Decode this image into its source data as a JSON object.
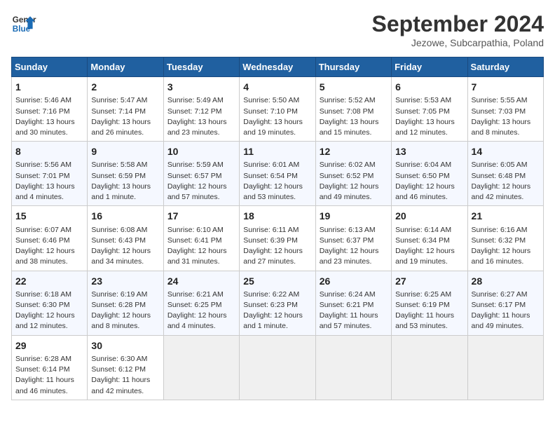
{
  "header": {
    "logo_line1": "General",
    "logo_line2": "Blue",
    "month": "September 2024",
    "location": "Jezowe, Subcarpathia, Poland"
  },
  "columns": [
    "Sunday",
    "Monday",
    "Tuesday",
    "Wednesday",
    "Thursday",
    "Friday",
    "Saturday"
  ],
  "weeks": [
    [
      {
        "day": "1",
        "info": "Sunrise: 5:46 AM\nSunset: 7:16 PM\nDaylight: 13 hours\nand 30 minutes."
      },
      {
        "day": "2",
        "info": "Sunrise: 5:47 AM\nSunset: 7:14 PM\nDaylight: 13 hours\nand 26 minutes."
      },
      {
        "day": "3",
        "info": "Sunrise: 5:49 AM\nSunset: 7:12 PM\nDaylight: 13 hours\nand 23 minutes."
      },
      {
        "day": "4",
        "info": "Sunrise: 5:50 AM\nSunset: 7:10 PM\nDaylight: 13 hours\nand 19 minutes."
      },
      {
        "day": "5",
        "info": "Sunrise: 5:52 AM\nSunset: 7:08 PM\nDaylight: 13 hours\nand 15 minutes."
      },
      {
        "day": "6",
        "info": "Sunrise: 5:53 AM\nSunset: 7:05 PM\nDaylight: 13 hours\nand 12 minutes."
      },
      {
        "day": "7",
        "info": "Sunrise: 5:55 AM\nSunset: 7:03 PM\nDaylight: 13 hours\nand 8 minutes."
      }
    ],
    [
      {
        "day": "8",
        "info": "Sunrise: 5:56 AM\nSunset: 7:01 PM\nDaylight: 13 hours\nand 4 minutes."
      },
      {
        "day": "9",
        "info": "Sunrise: 5:58 AM\nSunset: 6:59 PM\nDaylight: 13 hours\nand 1 minute."
      },
      {
        "day": "10",
        "info": "Sunrise: 5:59 AM\nSunset: 6:57 PM\nDaylight: 12 hours\nand 57 minutes."
      },
      {
        "day": "11",
        "info": "Sunrise: 6:01 AM\nSunset: 6:54 PM\nDaylight: 12 hours\nand 53 minutes."
      },
      {
        "day": "12",
        "info": "Sunrise: 6:02 AM\nSunset: 6:52 PM\nDaylight: 12 hours\nand 49 minutes."
      },
      {
        "day": "13",
        "info": "Sunrise: 6:04 AM\nSunset: 6:50 PM\nDaylight: 12 hours\nand 46 minutes."
      },
      {
        "day": "14",
        "info": "Sunrise: 6:05 AM\nSunset: 6:48 PM\nDaylight: 12 hours\nand 42 minutes."
      }
    ],
    [
      {
        "day": "15",
        "info": "Sunrise: 6:07 AM\nSunset: 6:46 PM\nDaylight: 12 hours\nand 38 minutes."
      },
      {
        "day": "16",
        "info": "Sunrise: 6:08 AM\nSunset: 6:43 PM\nDaylight: 12 hours\nand 34 minutes."
      },
      {
        "day": "17",
        "info": "Sunrise: 6:10 AM\nSunset: 6:41 PM\nDaylight: 12 hours\nand 31 minutes."
      },
      {
        "day": "18",
        "info": "Sunrise: 6:11 AM\nSunset: 6:39 PM\nDaylight: 12 hours\nand 27 minutes."
      },
      {
        "day": "19",
        "info": "Sunrise: 6:13 AM\nSunset: 6:37 PM\nDaylight: 12 hours\nand 23 minutes."
      },
      {
        "day": "20",
        "info": "Sunrise: 6:14 AM\nSunset: 6:34 PM\nDaylight: 12 hours\nand 19 minutes."
      },
      {
        "day": "21",
        "info": "Sunrise: 6:16 AM\nSunset: 6:32 PM\nDaylight: 12 hours\nand 16 minutes."
      }
    ],
    [
      {
        "day": "22",
        "info": "Sunrise: 6:18 AM\nSunset: 6:30 PM\nDaylight: 12 hours\nand 12 minutes."
      },
      {
        "day": "23",
        "info": "Sunrise: 6:19 AM\nSunset: 6:28 PM\nDaylight: 12 hours\nand 8 minutes."
      },
      {
        "day": "24",
        "info": "Sunrise: 6:21 AM\nSunset: 6:25 PM\nDaylight: 12 hours\nand 4 minutes."
      },
      {
        "day": "25",
        "info": "Sunrise: 6:22 AM\nSunset: 6:23 PM\nDaylight: 12 hours\nand 1 minute."
      },
      {
        "day": "26",
        "info": "Sunrise: 6:24 AM\nSunset: 6:21 PM\nDaylight: 11 hours\nand 57 minutes."
      },
      {
        "day": "27",
        "info": "Sunrise: 6:25 AM\nSunset: 6:19 PM\nDaylight: 11 hours\nand 53 minutes."
      },
      {
        "day": "28",
        "info": "Sunrise: 6:27 AM\nSunset: 6:17 PM\nDaylight: 11 hours\nand 49 minutes."
      }
    ],
    [
      {
        "day": "29",
        "info": "Sunrise: 6:28 AM\nSunset: 6:14 PM\nDaylight: 11 hours\nand 46 minutes."
      },
      {
        "day": "30",
        "info": "Sunrise: 6:30 AM\nSunset: 6:12 PM\nDaylight: 11 hours\nand 42 minutes."
      },
      {
        "day": "",
        "info": ""
      },
      {
        "day": "",
        "info": ""
      },
      {
        "day": "",
        "info": ""
      },
      {
        "day": "",
        "info": ""
      },
      {
        "day": "",
        "info": ""
      }
    ]
  ]
}
